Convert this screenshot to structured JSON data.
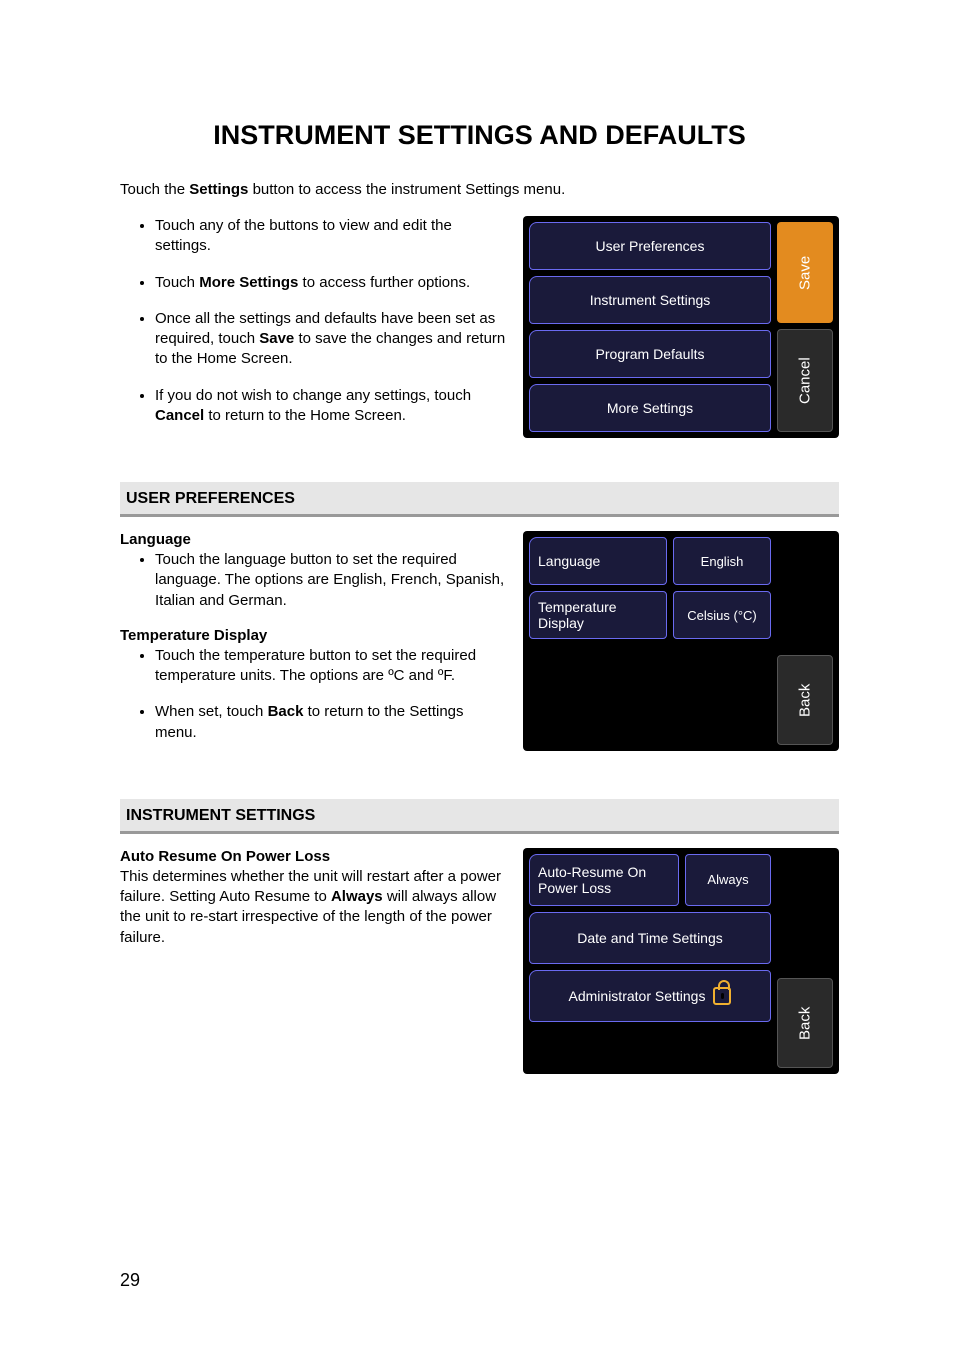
{
  "page": {
    "title": "INSTRUMENT SETTINGS AND DEFAULTS",
    "intro_pre": "Touch the ",
    "intro_bold": "Settings",
    "intro_post": " button to access the instrument Settings menu.",
    "page_number": "29"
  },
  "top_bullets": {
    "b1": "Touch any of the buttons to view and edit the settings.",
    "b2_pre": "Touch ",
    "b2_bold": "More Settings",
    "b2_post": " to access further options.",
    "b3_pre": "Once all the settings and defaults have been set as required, touch ",
    "b3_bold": "Save",
    "b3_post": " to save the changes and return to the Home Screen.",
    "b4_pre": "If you do not wish to change any settings, touch ",
    "b4_bold": "Cancel",
    "b4_post": " to return to the Home Screen."
  },
  "settings_menu": {
    "user_prefs": "User Preferences",
    "instr_settings": "Instrument Settings",
    "prog_defaults": "Program Defaults",
    "more_settings": "More Settings",
    "save": "Save",
    "cancel": "Cancel"
  },
  "user_prefs_section": {
    "heading": "USER PREFERENCES",
    "lang_head": "Language",
    "lang_bullet": "Touch the language button to set the required language. The options are English, French, Spanish, Italian and German.",
    "temp_head": "Temperature Display",
    "temp_bullet": "Touch the temperature button to set the required temperature units. The options are ºC and ºF.",
    "back_bullet_pre": "When set, touch ",
    "back_bullet_bold": "Back",
    "back_bullet_post": " to return to the Settings menu."
  },
  "user_prefs_device": {
    "language_label": "Language",
    "language_value": "English",
    "temp_label": "Temperature Display",
    "temp_value": "Celsius (°C)",
    "back": "Back"
  },
  "instr_section": {
    "heading": "INSTRUMENT SETTINGS",
    "ar_head": "Auto Resume On Power Loss",
    "ar_para_pre": "This determines whether the unit will restart after a power failure. Setting Auto Resume to ",
    "ar_para_bold": "Always",
    "ar_para_post": " will always allow the unit to re-start irrespective of the length of the power failure."
  },
  "instr_device": {
    "auto_resume_label": "Auto-Resume On Power Loss",
    "auto_resume_value": "Always",
    "date_time": "Date and Time Settings",
    "admin": "Administrator Settings",
    "back": "Back"
  }
}
